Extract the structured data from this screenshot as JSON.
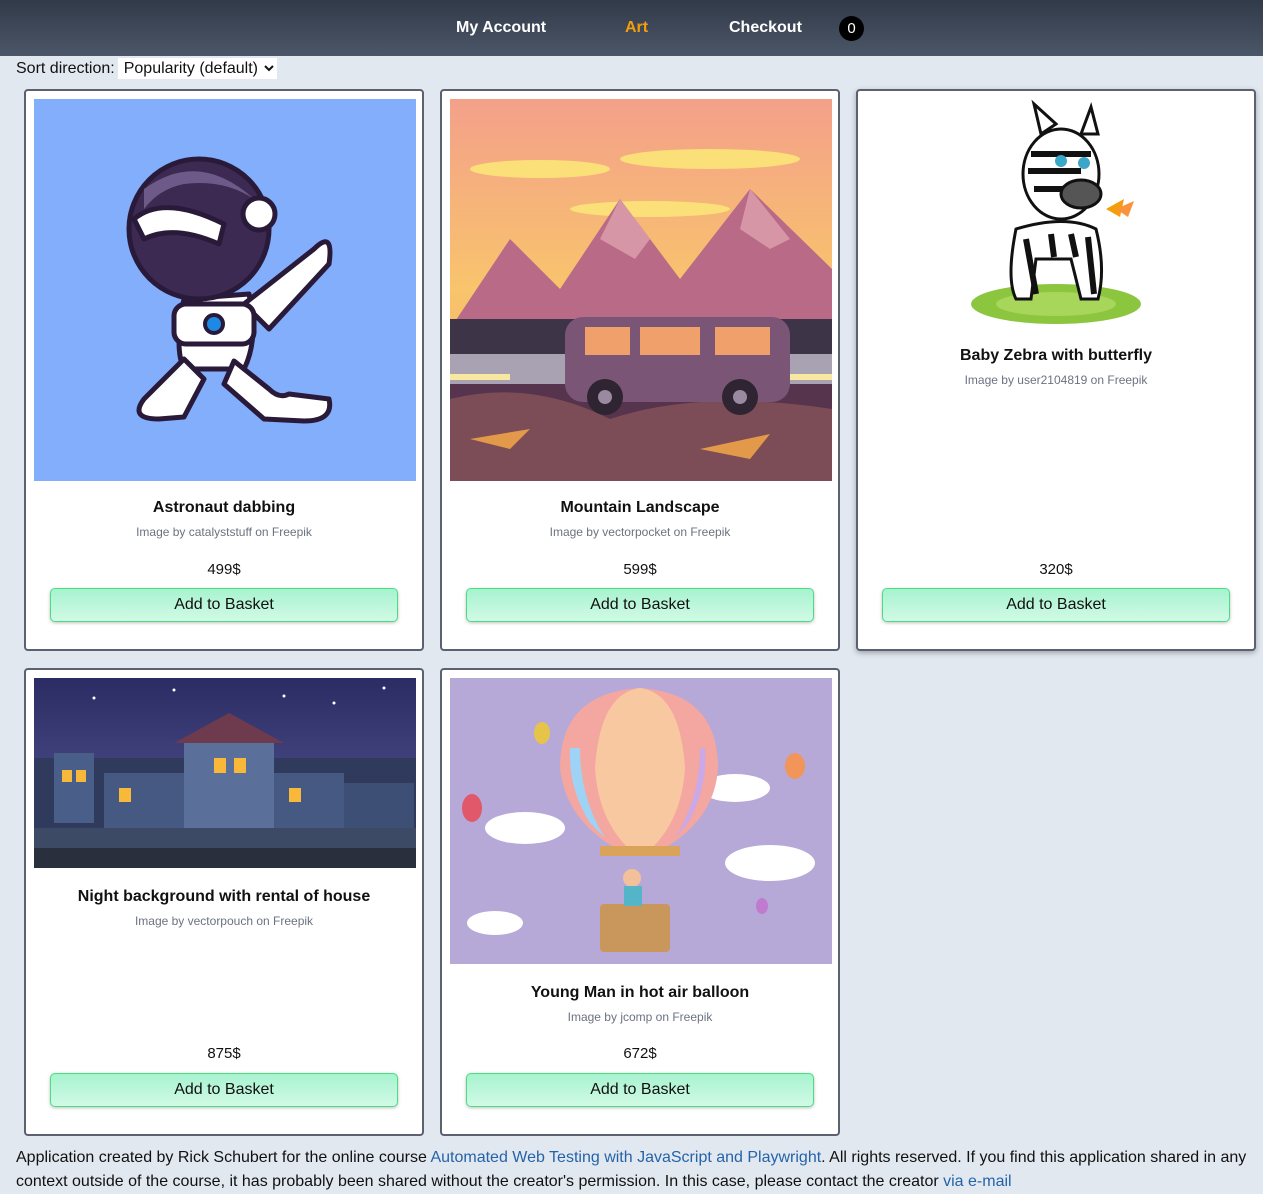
{
  "nav": {
    "my_account": "My Account",
    "art": "Art",
    "checkout": "Checkout",
    "basket_count": "0"
  },
  "sort": {
    "label": "Sort direction:",
    "selected": "Popularity (default)"
  },
  "products": [
    {
      "title": "Astronaut dabbing",
      "credit": "Image by catalyststuff on Freepik",
      "price": "499$",
      "button": "Add to Basket"
    },
    {
      "title": "Mountain Landscape",
      "credit": "Image by vectorpocket on Freepik",
      "price": "599$",
      "button": "Add to Basket"
    },
    {
      "title": "Baby Zebra with butterfly",
      "credit": "Image by user2104819 on Freepik",
      "price": "320$",
      "button": "Add to Basket"
    },
    {
      "title": "Night background with rental of house",
      "credit": "Image by vectorpouch on Freepik",
      "price": "875$",
      "button": "Add to Basket"
    },
    {
      "title": "Young Man in hot air balloon",
      "credit": "Image by jcomp on Freepik",
      "price": "672$",
      "button": "Add to Basket"
    }
  ],
  "footer": {
    "text_before": "Application created by Rick Schubert for the online course ",
    "course_link": "Automated Web Testing with JavaScript and Playwright",
    "text_after": ". All rights reserved. If you find this application shared in any context outside of the course, it has probably been shared without the creator's permission. In this case, please contact the creator ",
    "contact_link": "via e-mail"
  }
}
